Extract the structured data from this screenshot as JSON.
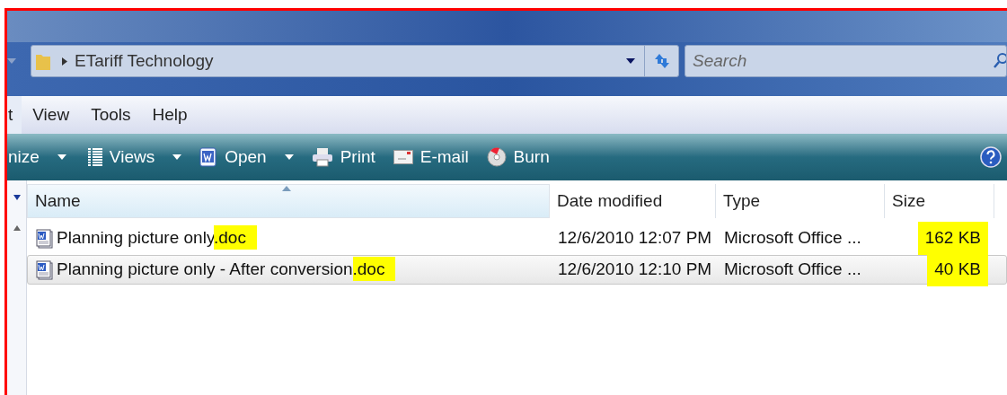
{
  "address_bar": {
    "path": "ETariff Technology"
  },
  "search": {
    "placeholder": "Search"
  },
  "menu": [
    {
      "label": "t",
      "highlighted": true
    },
    {
      "label": "View",
      "highlighted": false
    },
    {
      "label": "Tools",
      "highlighted": false
    },
    {
      "label": "Help",
      "highlighted": false
    }
  ],
  "toolbar": [
    {
      "label": "nize",
      "kind": "none",
      "dropdown": true
    },
    {
      "label": "Views",
      "kind": "views",
      "dropdown": true
    },
    {
      "label": "Open",
      "kind": "word",
      "dropdown": true
    },
    {
      "label": "Print",
      "kind": "print",
      "dropdown": false
    },
    {
      "label": "E-mail",
      "kind": "mail",
      "dropdown": false
    },
    {
      "label": "Burn",
      "kind": "burn",
      "dropdown": false
    }
  ],
  "table": {
    "columns": [
      {
        "label": "Name",
        "sorted": true
      },
      {
        "label": "Date modified",
        "sorted": false
      },
      {
        "label": "Type",
        "sorted": false
      },
      {
        "label": "Size",
        "sorted": false
      }
    ],
    "rows": [
      {
        "name": "Planning picture only",
        "extension": ".doc",
        "extension_highlighted": true,
        "date_modified": "12/6/2010 12:07 PM",
        "type": "Microsoft Office ...",
        "size": "162 KB",
        "size_highlighted": true,
        "selected": false
      },
      {
        "name": "Planning picture only - After conversion",
        "extension": ".doc",
        "extension_highlighted": true,
        "date_modified": "12/6/2010 12:10 PM",
        "type": "Microsoft Office ...",
        "size": "40 KB",
        "size_highlighted": true,
        "selected": true
      }
    ]
  }
}
